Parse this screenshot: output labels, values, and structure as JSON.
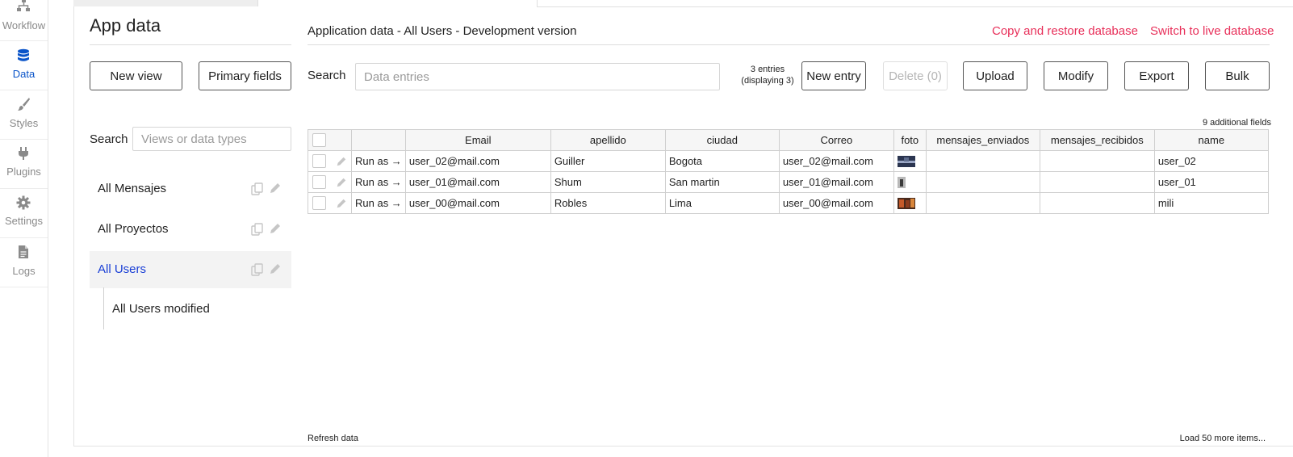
{
  "rail": {
    "items": [
      {
        "label": "Workflow",
        "icon": "sitemap-icon",
        "active": false
      },
      {
        "label": "Data",
        "icon": "database-icon",
        "active": true
      },
      {
        "label": "Styles",
        "icon": "brush-icon",
        "active": false
      },
      {
        "label": "Plugins",
        "icon": "plug-icon",
        "active": false
      },
      {
        "label": "Settings",
        "icon": "gear-icon",
        "active": false
      },
      {
        "label": "Logs",
        "icon": "document-icon",
        "active": false
      }
    ]
  },
  "left": {
    "title": "App data",
    "new_view": "New view",
    "primary_fields": "Primary fields",
    "search_label": "Search",
    "search_placeholder": "Views or data types",
    "views": [
      {
        "label": "All Mensajes",
        "selected": false
      },
      {
        "label": "All Proyectos",
        "selected": false
      },
      {
        "label": "All Users",
        "selected": true
      }
    ],
    "sub_view": "All Users modified"
  },
  "main": {
    "header": "Application data - All Users - Development version",
    "copy_restore": "Copy and restore database",
    "switch_live": "Switch to live database",
    "search_label": "Search",
    "search_placeholder": "Data entries",
    "entries_info": "3 entries (displaying 3)",
    "buttons": {
      "new_entry": "New entry",
      "delete": "Delete (0)",
      "upload": "Upload",
      "modify": "Modify",
      "export": "Export",
      "bulk": "Bulk"
    },
    "additional_fields": "9 additional fields",
    "columns": [
      "Email",
      "apellido",
      "ciudad",
      "Correo",
      "foto",
      "mensajes_enviados",
      "mensajes_recibidos",
      "name"
    ],
    "run_as": "Run as →",
    "rows": [
      {
        "email": "user_02@mail.com",
        "apellido": "Guiller",
        "ciudad": "Bogota",
        "correo": "user_02@mail.com",
        "foto": "photo-thumbnail",
        "enviados": "",
        "recibidos": "",
        "name": "user_02"
      },
      {
        "email": "user_01@mail.com",
        "apellido": "Shum",
        "ciudad": "San martin",
        "correo": "user_01@mail.com",
        "foto": "photo-thumbnail",
        "enviados": "",
        "recibidos": "",
        "name": "user_01"
      },
      {
        "email": "user_00@mail.com",
        "apellido": "Robles",
        "ciudad": "Lima",
        "correo": "user_00@mail.com",
        "foto": "photo-thumbnail",
        "enviados": "",
        "recibidos": "",
        "name": "mili"
      }
    ],
    "refresh": "Refresh data",
    "load_more": "Load 50 more items..."
  },
  "colors": {
    "accent_link": "#e8305a",
    "active_blue": "#0a54c9",
    "selected_view": "#1a3fd6"
  }
}
